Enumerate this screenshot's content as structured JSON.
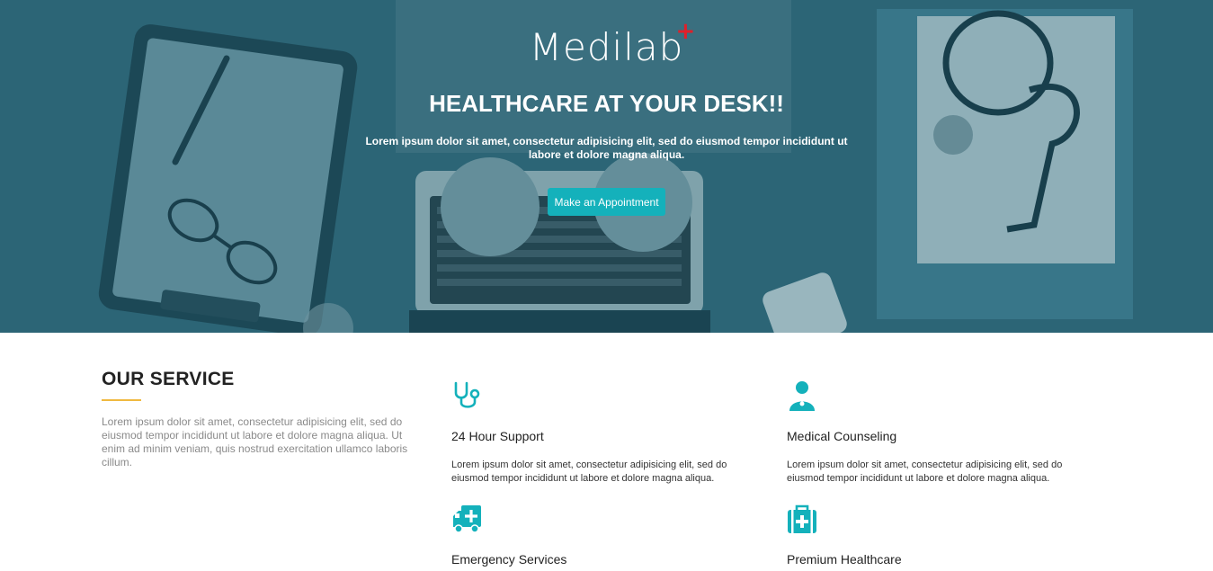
{
  "hero": {
    "logo": "Medilab",
    "logo_mark": "+",
    "title": "HEALTHCARE AT YOUR DESK!!",
    "subtitle": "Lorem ipsum dolor sit amet, consectetur adipisicing elit, sed do eiusmod tempor incididunt ut labore et dolore magna aliqua.",
    "cta_label": "Make an Appointment"
  },
  "services": {
    "title": "OUR SERVICE",
    "description": "Lorem ipsum dolor sit amet, consectetur adipisicing elit, sed do eiusmod tempor incididunt ut labore et dolore magna aliqua. Ut enim ad minim veniam, quis nostrud exercitation ullamco laboris cillum.",
    "items": [
      {
        "icon": "stethoscope-icon",
        "title": "24 Hour Support",
        "text": "Lorem ipsum dolor sit amet, consectetur adipisicing elit, sed do eiusmod tempor incididunt ut labore et dolore magna aliqua."
      },
      {
        "icon": "doctor-icon",
        "title": "Medical Counseling",
        "text": "Lorem ipsum dolor sit amet, consectetur adipisicing elit, sed do eiusmod tempor incididunt ut labore et dolore magna aliqua."
      },
      {
        "icon": "ambulance-icon",
        "title": "Emergency Services",
        "text": ""
      },
      {
        "icon": "medkit-icon",
        "title": "Premium Healthcare",
        "text": ""
      }
    ]
  },
  "colors": {
    "accent": "#14b1bb",
    "hero_tint": "#326877",
    "underline": "#f0b940",
    "logo_mark": "#e0202a"
  }
}
